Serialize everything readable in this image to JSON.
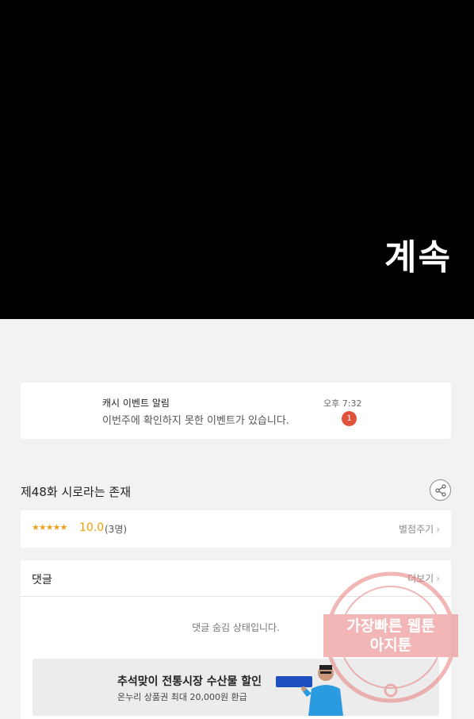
{
  "comic": {
    "panel_text": "계속"
  },
  "notification": {
    "title": "캐시 이벤트 알림",
    "message": "이번주에 확인하지 못한 이벤트가 있습니다.",
    "time": "오후 7:32",
    "badge": "1"
  },
  "episode": {
    "title": "제48화 시로라는 존재"
  },
  "rating": {
    "stars": "★★★★★",
    "score": "10.0",
    "count": "(3명)",
    "rate_label": "별점주기"
  },
  "comments": {
    "title": "댓글",
    "more_label": "더보기",
    "hidden_message": "댓글 숨김 상태입니다."
  },
  "ad": {
    "title": "추석맞이 전통시장 수산물 할인",
    "subtitle": "온누리 상품권 최대 20,000원 환급"
  },
  "watermark": {
    "line1": "가장빠른 웹툰",
    "line2": "아지툰"
  },
  "colors": {
    "badge": "#e0533a",
    "star": "#f0a020",
    "watermark": "#e87c7c"
  }
}
